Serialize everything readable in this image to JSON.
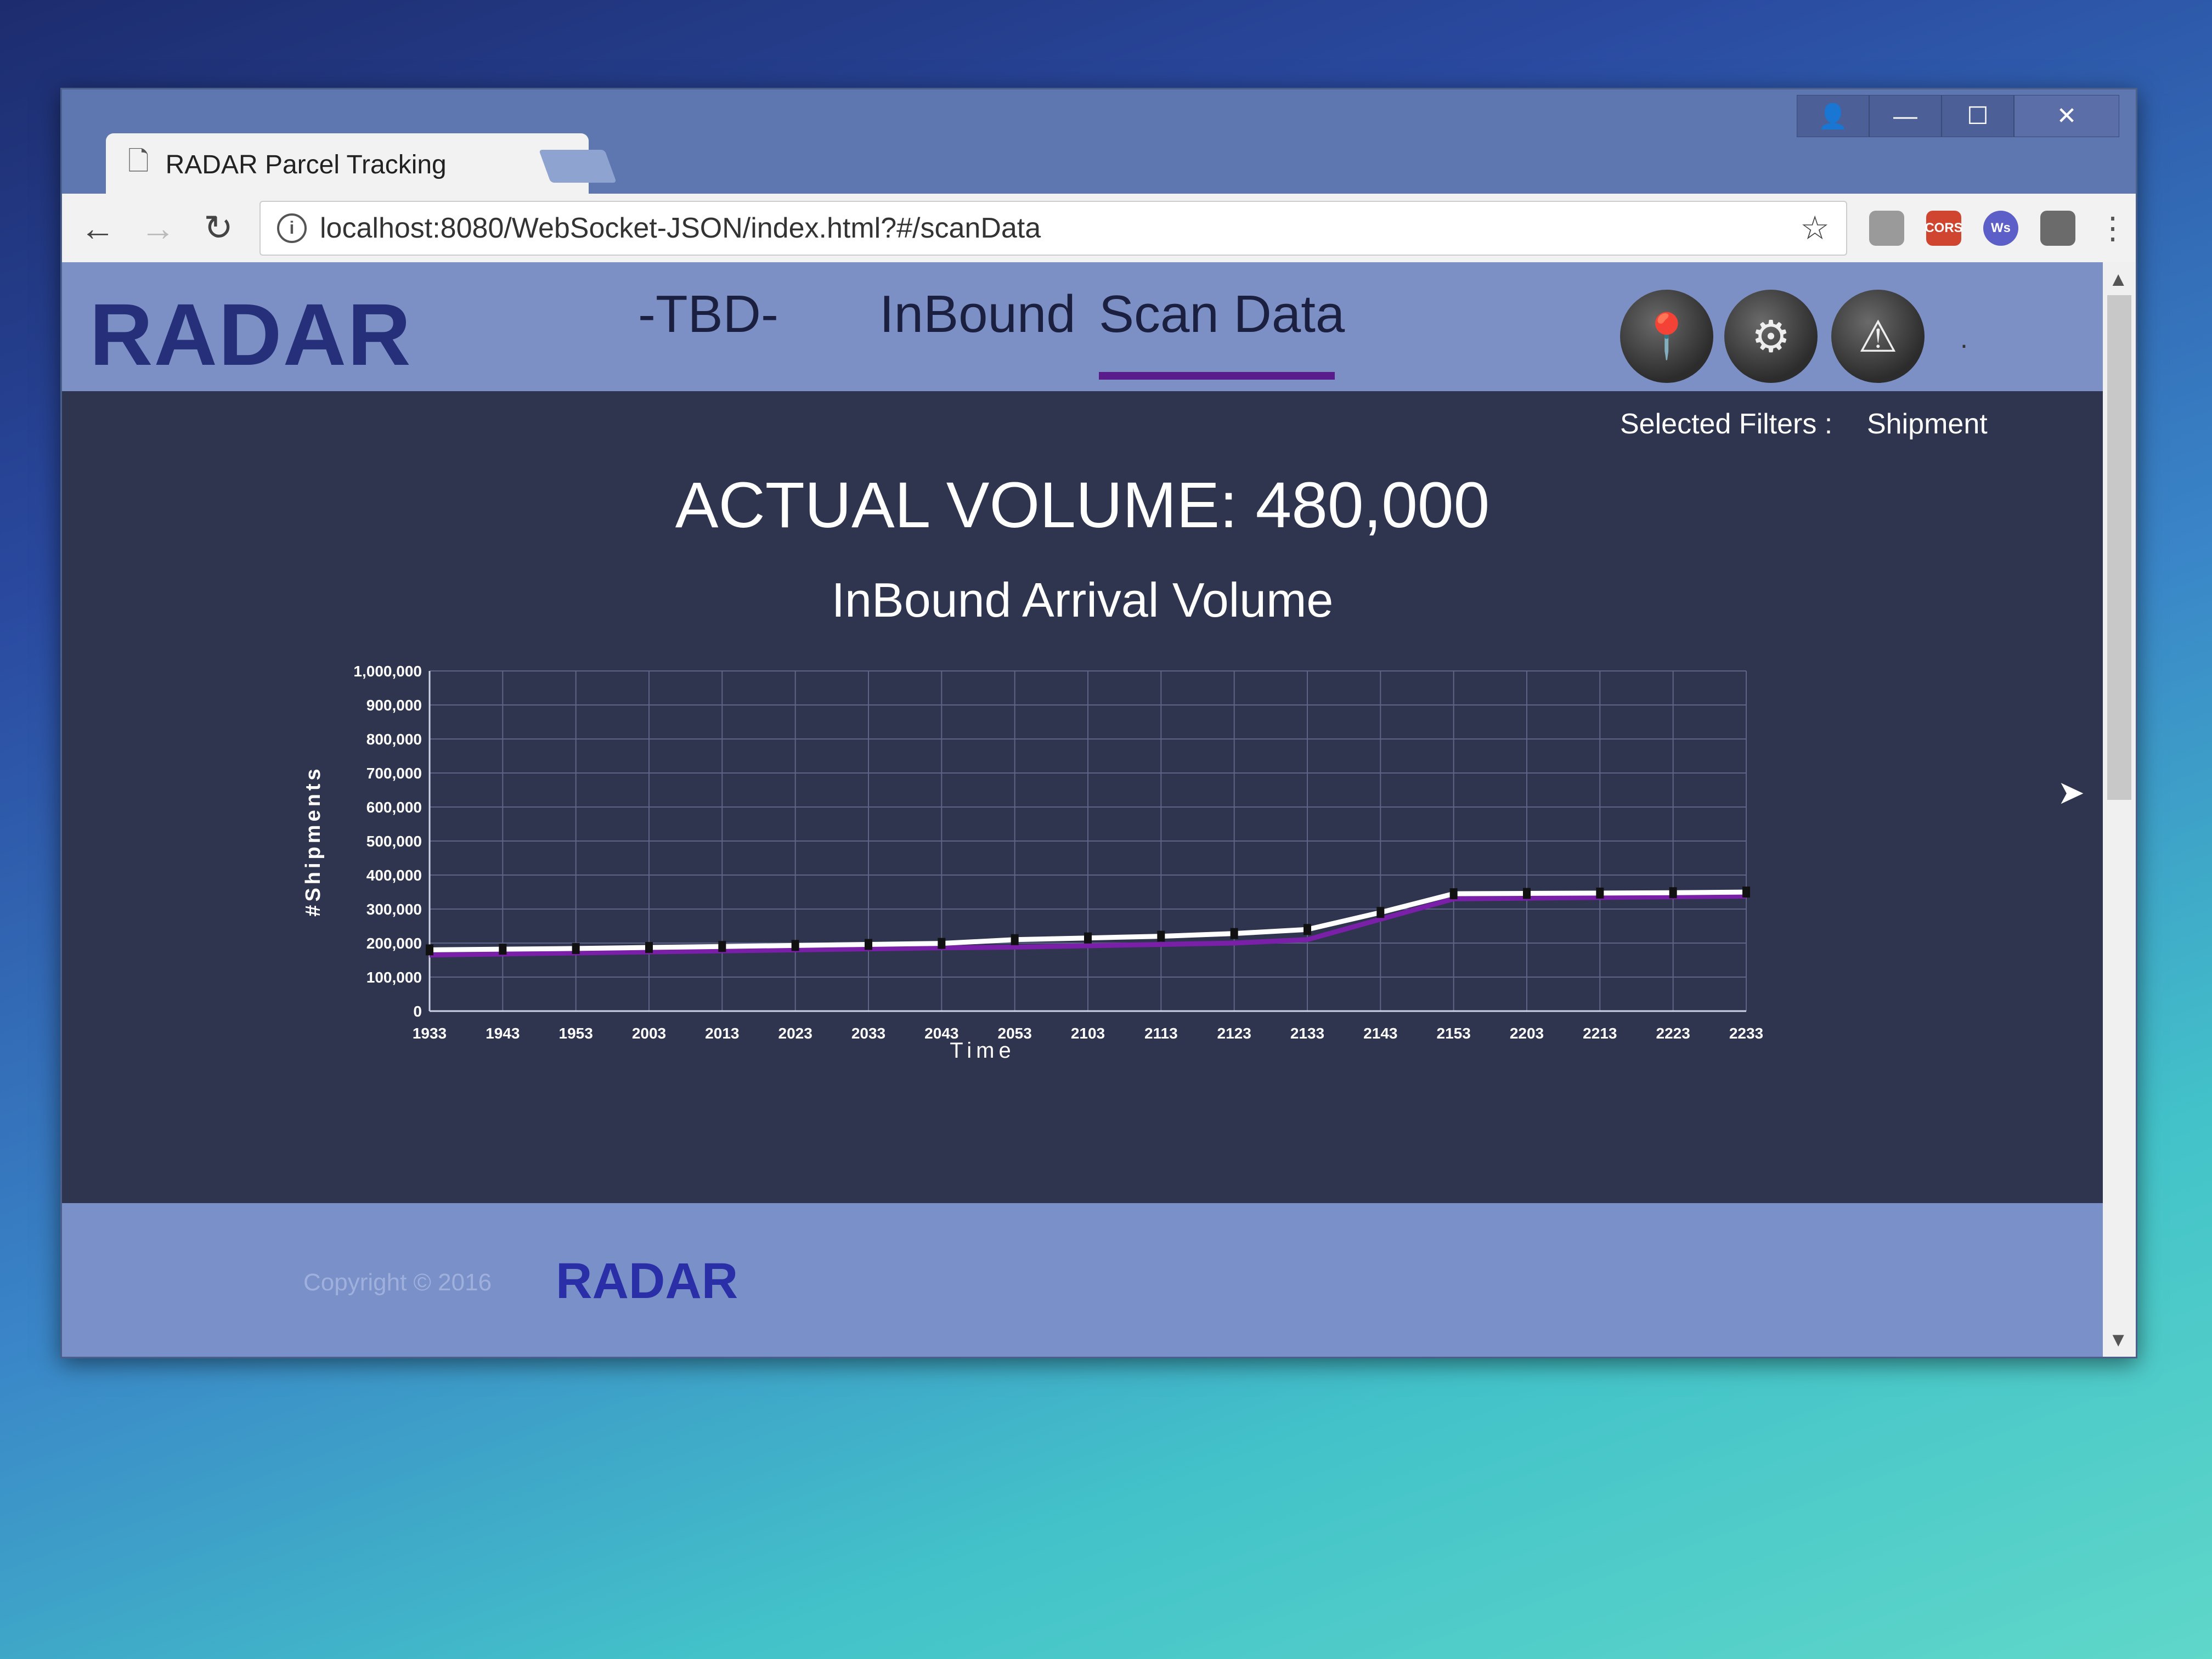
{
  "browser": {
    "tab_title": "RADAR Parcel Tracking",
    "tab_close": "×",
    "url": "localhost:8080/WebSocket-JSON/index.html?#/scanData",
    "window_controls": {
      "user": "👤",
      "minimize": "—",
      "maximize": "☐",
      "close": "✕"
    },
    "extensions": [
      {
        "icon": "pdf-extension-icon",
        "label": "",
        "color": "#9a9a9a"
      },
      {
        "icon": "cors-extension-icon",
        "label": "CORS",
        "color": "#d0452f"
      },
      {
        "icon": "ws-extension-icon",
        "label": "Ws",
        "color": "#5b5fc7"
      },
      {
        "icon": "notes-extension-icon",
        "label": "",
        "color": "#6b6b6b"
      }
    ]
  },
  "app": {
    "logo": "RADAR",
    "nav": {
      "tbd": "-TBD-",
      "inbound": "InBound",
      "scan_data": "Scan Data",
      "active": "scan_data"
    },
    "header_dot": "."
  },
  "filters": {
    "label": "Selected Filters :",
    "value": "Shipment"
  },
  "summary": {
    "actual_volume": "ACTUAL VOLUME: 480,000"
  },
  "chart_data": {
    "type": "line",
    "title": "InBound Arrival Volume",
    "xlabel": "Time",
    "ylabel": "#Shipments",
    "ylim": [
      0,
      1000000
    ],
    "yticks": [
      "0",
      "100,000",
      "200,000",
      "300,000",
      "400,000",
      "500,000",
      "600,000",
      "700,000",
      "800,000",
      "900,000",
      "1,000,000"
    ],
    "x": [
      "1933",
      "1943",
      "1953",
      "2003",
      "2013",
      "2023",
      "2033",
      "2043",
      "2053",
      "2103",
      "2113",
      "2123",
      "2133",
      "2143",
      "2153",
      "2203",
      "2213",
      "2223",
      "2233"
    ],
    "series": [
      {
        "color": "#ffffff",
        "values": [
          180000,
          182000,
          184000,
          187000,
          190000,
          193000,
          196000,
          199000,
          210000,
          215000,
          220000,
          228000,
          240000,
          290000,
          345000,
          346000,
          347000,
          348000,
          350000
        ]
      },
      {
        "color": "#7a1fa8",
        "values": [
          165000,
          168000,
          171000,
          174000,
          177000,
          180000,
          183000,
          186000,
          188000,
          192000,
          196000,
          200000,
          210000,
          270000,
          330000,
          332000,
          334000,
          336000,
          338000
        ]
      }
    ],
    "grid": true,
    "legend": "none"
  },
  "footer": {
    "copyright": "Copyright © 2016",
    "logo": "RADAR"
  }
}
